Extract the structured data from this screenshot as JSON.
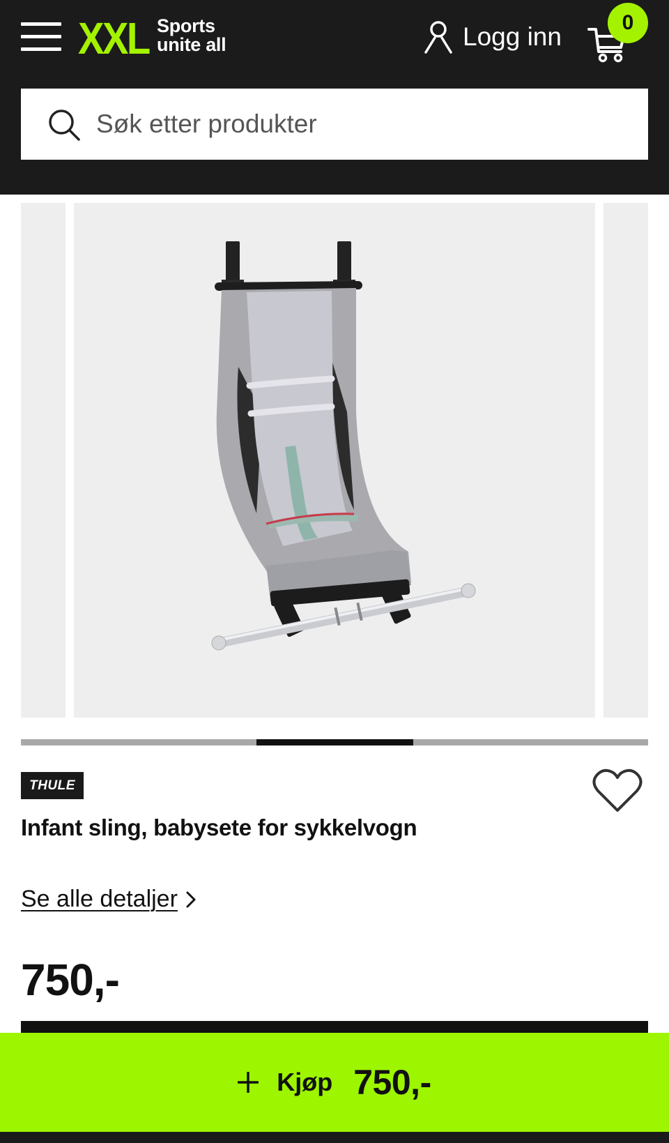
{
  "header": {
    "logo_mark": "XXL",
    "logo_tagline_1": "Sports",
    "logo_tagline_2": "unite all",
    "login_label": "Logg inn",
    "cart_count": "0",
    "accent_color": "#a4f200",
    "background_color": "#1b1b1b"
  },
  "search": {
    "placeholder": "Søk etter produkter",
    "value": ""
  },
  "gallery": {
    "image_count": 3,
    "active_index": 2,
    "background_color": "#eeeeee"
  },
  "product": {
    "brand": "THULE",
    "title": "Infant sling, babysete for sykkelvogn",
    "details_link": "Se alle detaljer",
    "price": "750,-"
  },
  "buy_bar": {
    "label": "Kjøp",
    "price": "750,-",
    "color": "#9df500"
  },
  "icons": [
    "menu-icon",
    "user-icon",
    "cart-icon",
    "search-icon",
    "heart-icon",
    "chevron-right-icon",
    "plus-icon"
  ]
}
